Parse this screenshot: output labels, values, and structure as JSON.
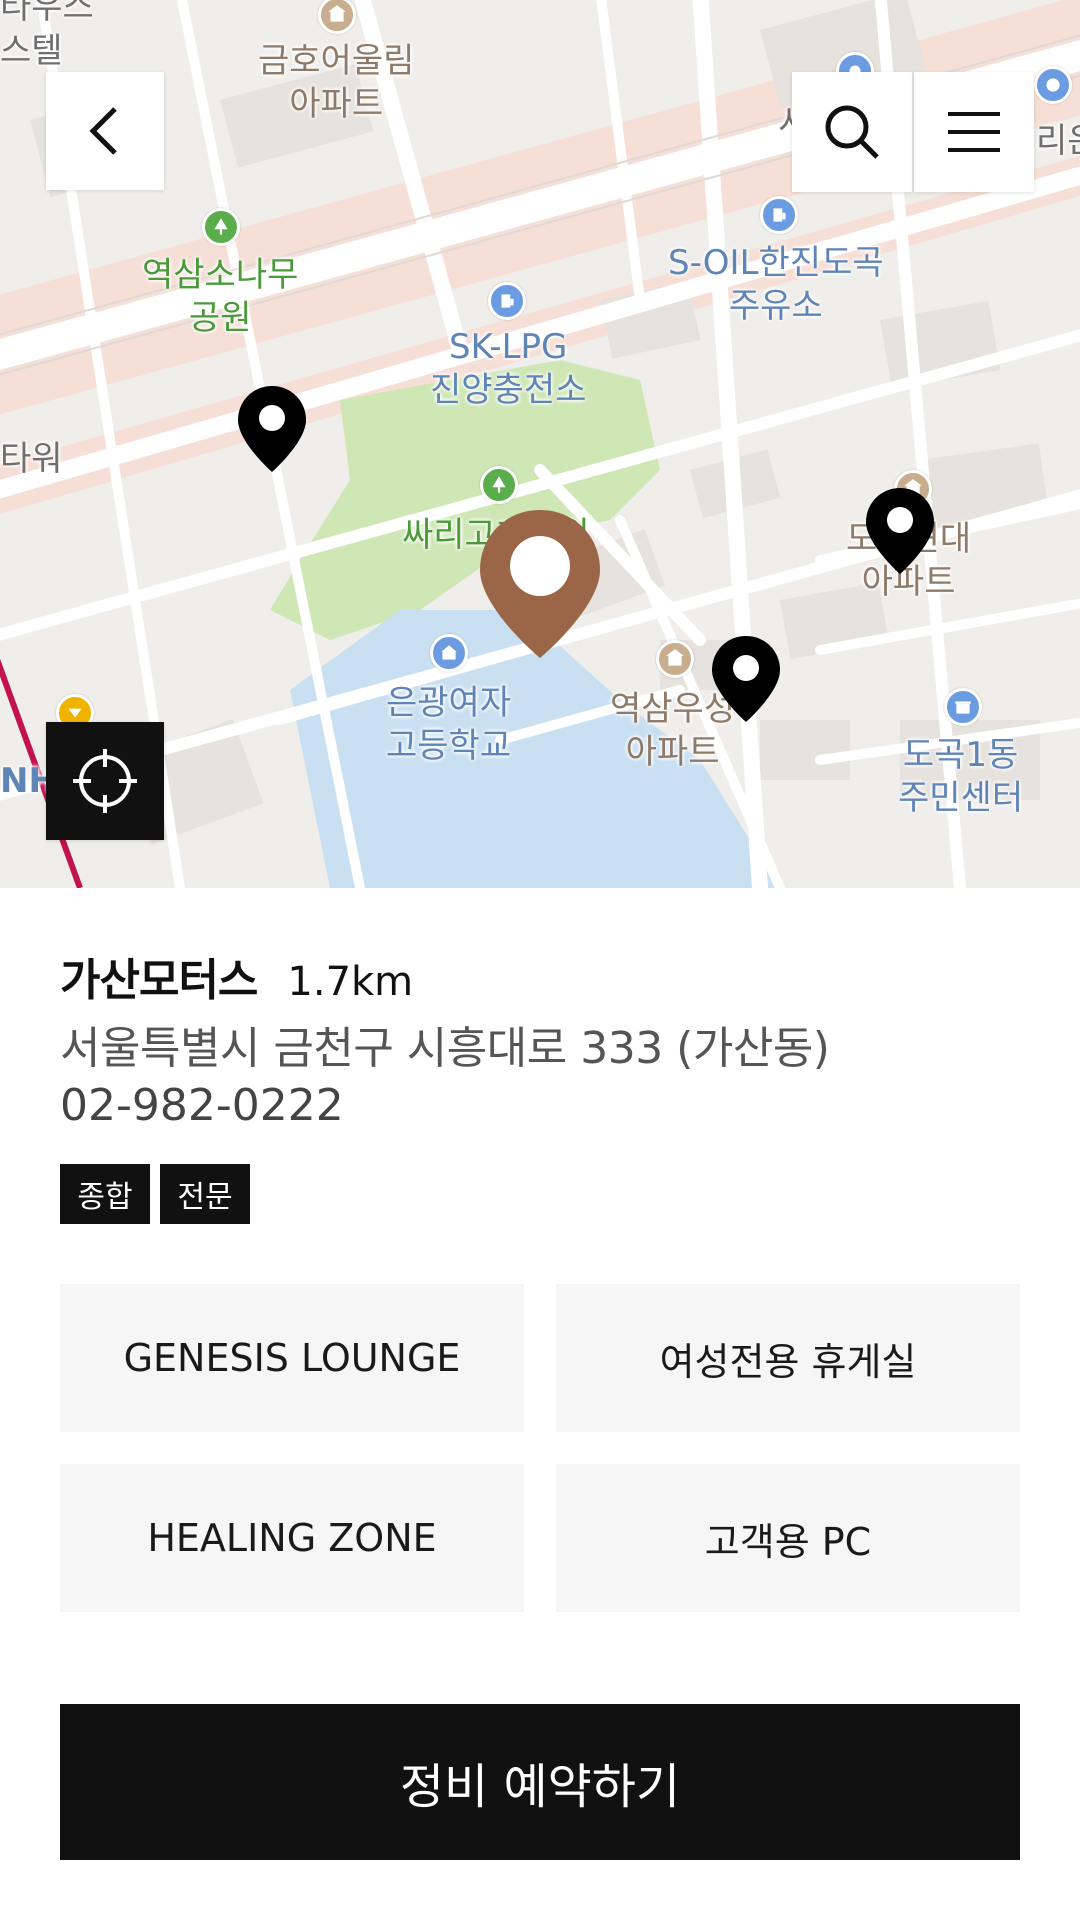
{
  "map": {
    "labels": {
      "top_left_partial_1": "타우스",
      "top_left_partial_2": "스텔",
      "apartment_top": [
        "금호어울림",
        "아파트"
      ],
      "park": [
        "역삼소나무",
        "공원"
      ],
      "gas_station_sk": [
        "SK-LPG",
        "진양충전소"
      ],
      "gas_station_soil": [
        "S-OIL한진도곡",
        "주유소"
      ],
      "left_edge": "타워",
      "hill_park": "싸리고개공원",
      "school": [
        "은광여자",
        "고등학교"
      ],
      "apartment_center": [
        "역삼우성",
        "아파트"
      ],
      "apartment_right": [
        "도곡현대",
        "아파트"
      ],
      "community_center": [
        "도곡1동",
        "주민센터"
      ],
      "left_bottom_partial": "NH",
      "top_right_partial": "리은",
      "top_center_partial": "서"
    },
    "colors": {
      "selected_marker": "#9b6547",
      "marker": "#000000"
    }
  },
  "controls": {
    "back_icon": "chevron-left-icon",
    "search_icon": "search-icon",
    "menu_icon": "hamburger-menu-icon",
    "locate_icon": "crosshair-icon"
  },
  "dealer": {
    "name": "가산모터스",
    "distance": "1.7km",
    "address": "서울특별시 금천구 시흥대로 333 (가산동)",
    "phone": "02-982-0222",
    "tags": [
      "종합",
      "전문"
    ]
  },
  "amenities": [
    "GENESIS LOUNGE",
    "여성전용 휴게실",
    "HEALING ZONE",
    "고객용 PC"
  ],
  "cta": {
    "label": "정비 예약하기"
  }
}
